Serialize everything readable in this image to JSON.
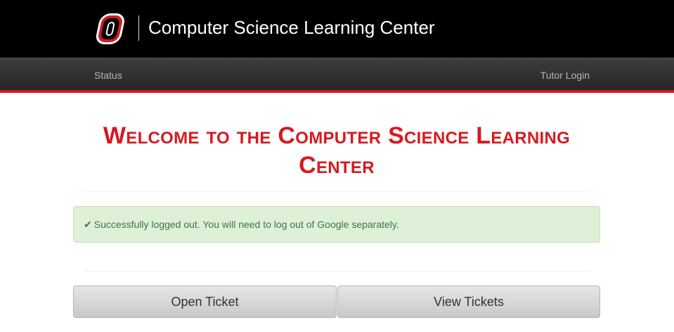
{
  "header": {
    "brand_title": "Computer Science Learning Center"
  },
  "nav": {
    "status_label": "Status",
    "login_label": "Tutor Login"
  },
  "main": {
    "heading": "Welcome to the Computer Science Learning Center",
    "alert": {
      "check_glyph": "✔",
      "message": "Successfully logged out. You will need to log out of Google separately."
    },
    "buttons": {
      "open_ticket": "Open Ticket",
      "view_tickets": "View Tickets"
    }
  },
  "colors": {
    "brand_red": "#d71920",
    "header_black": "#000000",
    "alert_green_bg": "#dff0d8",
    "alert_green_text": "#3c763d"
  },
  "icons": {
    "logo": "unomaha-o-logo-icon",
    "check": "check-icon"
  }
}
